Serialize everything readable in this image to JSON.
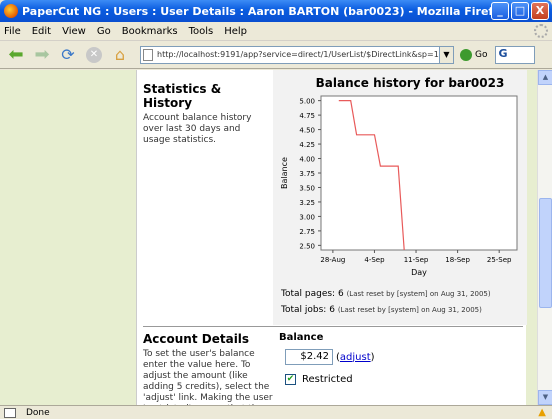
{
  "window": {
    "title": "PaperCut NG : Users : User Details : Aaron BARTON (bar0023) - Mozilla Firefox",
    "buttons": [
      "_",
      "□",
      "X"
    ]
  },
  "menu": [
    "File",
    "Edit",
    "View",
    "Go",
    "Bookmarks",
    "Tools",
    "Help"
  ],
  "toolbar": {
    "url": "http://localhost:9191/app?service=direct/1/UserList/$DirectLink&sp=11141",
    "go_label": "Go",
    "search_text": "G"
  },
  "stats": {
    "title": "Statistics & History",
    "description": "Account balance history over last 30 days and usage statistics.",
    "total_pages_label": "Total pages:",
    "total_pages_value": "6",
    "total_pages_note": "(Last reset by [system] on Aug 31, 2005)",
    "total_jobs_label": "Total jobs:",
    "total_jobs_value": "6",
    "total_jobs_note": "(Last reset by [system] on Aug 31, 2005)"
  },
  "chart_data": {
    "type": "line",
    "title": "Balance history for bar0023",
    "xlabel": "Day",
    "ylabel": "Balance",
    "x_ticks": [
      "28-Aug",
      "4-Sep",
      "11-Sep",
      "18-Sep",
      "25-Sep"
    ],
    "y_ticks": [
      2.5,
      2.75,
      3.0,
      3.25,
      3.5,
      3.75,
      4.0,
      4.25,
      4.5,
      4.75,
      5.0
    ],
    "ylim": [
      2.42,
      5.08
    ],
    "xlim_days": [
      -2,
      31
    ],
    "series": [
      {
        "points": [
          {
            "x": "29-Aug",
            "y": 5.0
          },
          {
            "x": "31-Aug",
            "y": 5.0
          },
          {
            "x": "1-Sep",
            "y": 4.41
          },
          {
            "x": "4-Sep",
            "y": 4.41
          },
          {
            "x": "5-Sep",
            "y": 3.87
          },
          {
            "x": "8-Sep",
            "y": 3.87
          },
          {
            "x": "9-Sep",
            "y": 2.42
          }
        ],
        "color": "#e85a5a"
      }
    ],
    "grid": false
  },
  "account": {
    "title": "Account Details",
    "description": "To set the user's balance enter the value here. To adjust the amount (like adding 5 credits), select the 'adjust' link. Making the user 'restricted' means that they will not be able to print",
    "balance_label": "Balance",
    "balance_value": "$2.42",
    "adjust_open": "(",
    "adjust_label": "adjust",
    "adjust_close": ")",
    "restricted_label": "Restricted",
    "restricted_checked": "✔"
  },
  "status": {
    "text": "Done"
  }
}
